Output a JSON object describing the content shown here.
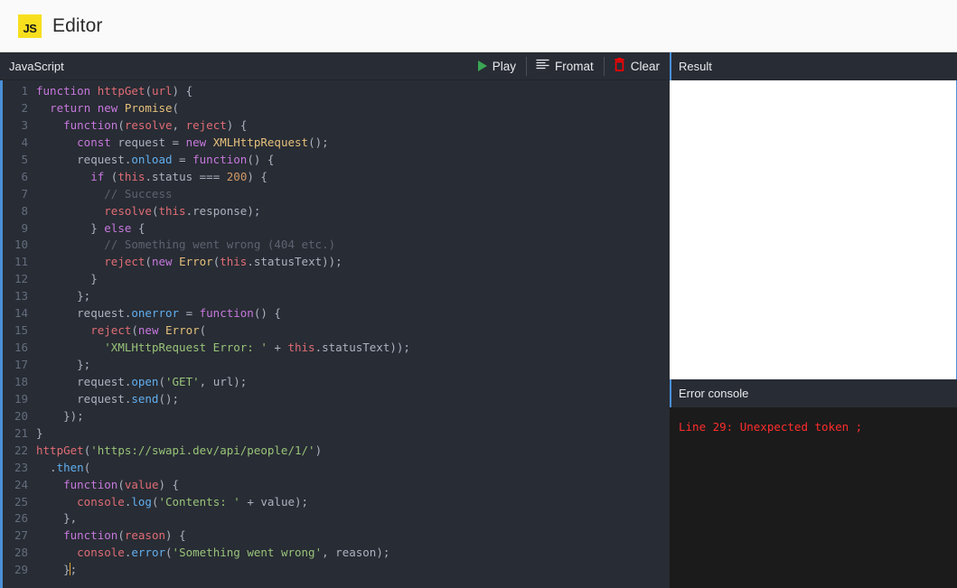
{
  "titlebar": {
    "logo_text": "JS",
    "title": "Editor",
    "logo_color": "#f7df1e"
  },
  "editor": {
    "language_label": "JavaScript",
    "toolbar": [
      {
        "label": "Play",
        "icon": "play-icon",
        "color": "#3aa655"
      },
      {
        "label": "Fromat",
        "icon": "format-icon",
        "color": "#e8eaed"
      },
      {
        "label": "Clear",
        "icon": "trash-icon",
        "color": "#ff0000"
      }
    ],
    "cursor_line": 29,
    "lines": [
      {
        "n": 1,
        "tokens": [
          {
            "t": "kw",
            "s": "function"
          },
          {
            "t": "pun",
            "s": " "
          },
          {
            "t": "fn",
            "s": "httpGet"
          },
          {
            "t": "pun",
            "s": "("
          },
          {
            "t": "var",
            "s": "url"
          },
          {
            "t": "pun",
            "s": ") {"
          }
        ]
      },
      {
        "n": 2,
        "tokens": [
          {
            "t": "pun",
            "s": "  "
          },
          {
            "t": "kw",
            "s": "return"
          },
          {
            "t": "pun",
            "s": " "
          },
          {
            "t": "kw",
            "s": "new"
          },
          {
            "t": "pun",
            "s": " "
          },
          {
            "t": "cls",
            "s": "Promise"
          },
          {
            "t": "pun",
            "s": "("
          }
        ]
      },
      {
        "n": 3,
        "tokens": [
          {
            "t": "pun",
            "s": "    "
          },
          {
            "t": "kw",
            "s": "function"
          },
          {
            "t": "pun",
            "s": "("
          },
          {
            "t": "var",
            "s": "resolve"
          },
          {
            "t": "pun",
            "s": ", "
          },
          {
            "t": "var",
            "s": "reject"
          },
          {
            "t": "pun",
            "s": ") {"
          }
        ]
      },
      {
        "n": 4,
        "tokens": [
          {
            "t": "pun",
            "s": "      "
          },
          {
            "t": "kw",
            "s": "const"
          },
          {
            "t": "pun",
            "s": " request = "
          },
          {
            "t": "kw",
            "s": "new"
          },
          {
            "t": "pun",
            "s": " "
          },
          {
            "t": "cls",
            "s": "XMLHttpRequest"
          },
          {
            "t": "pun",
            "s": "();"
          }
        ]
      },
      {
        "n": 5,
        "tokens": [
          {
            "t": "pun",
            "s": "      request."
          },
          {
            "t": "prop",
            "s": "onload"
          },
          {
            "t": "pun",
            "s": " = "
          },
          {
            "t": "kw",
            "s": "function"
          },
          {
            "t": "pun",
            "s": "() {"
          }
        ]
      },
      {
        "n": 6,
        "tokens": [
          {
            "t": "pun",
            "s": "        "
          },
          {
            "t": "kw",
            "s": "if"
          },
          {
            "t": "pun",
            "s": " ("
          },
          {
            "t": "this",
            "s": "this"
          },
          {
            "t": "pun",
            "s": ".status === "
          },
          {
            "t": "num",
            "s": "200"
          },
          {
            "t": "pun",
            "s": ") {"
          }
        ]
      },
      {
        "n": 7,
        "tokens": [
          {
            "t": "com",
            "s": "          // Success"
          }
        ]
      },
      {
        "n": 8,
        "tokens": [
          {
            "t": "pun",
            "s": "          "
          },
          {
            "t": "fn",
            "s": "resolve"
          },
          {
            "t": "pun",
            "s": "("
          },
          {
            "t": "this",
            "s": "this"
          },
          {
            "t": "pun",
            "s": ".response);"
          }
        ]
      },
      {
        "n": 9,
        "tokens": [
          {
            "t": "pun",
            "s": "        } "
          },
          {
            "t": "kw",
            "s": "else"
          },
          {
            "t": "pun",
            "s": " {"
          }
        ]
      },
      {
        "n": 10,
        "tokens": [
          {
            "t": "com",
            "s": "          // Something went wrong (404 etc.)"
          }
        ]
      },
      {
        "n": 11,
        "tokens": [
          {
            "t": "pun",
            "s": "          "
          },
          {
            "t": "fn",
            "s": "reject"
          },
          {
            "t": "pun",
            "s": "("
          },
          {
            "t": "kw",
            "s": "new"
          },
          {
            "t": "pun",
            "s": " "
          },
          {
            "t": "cls",
            "s": "Error"
          },
          {
            "t": "pun",
            "s": "("
          },
          {
            "t": "this",
            "s": "this"
          },
          {
            "t": "pun",
            "s": ".statusText));"
          }
        ]
      },
      {
        "n": 12,
        "tokens": [
          {
            "t": "pun",
            "s": "        }"
          }
        ]
      },
      {
        "n": 13,
        "tokens": [
          {
            "t": "pun",
            "s": "      };"
          }
        ]
      },
      {
        "n": 14,
        "tokens": [
          {
            "t": "pun",
            "s": "      request."
          },
          {
            "t": "prop",
            "s": "onerror"
          },
          {
            "t": "pun",
            "s": " = "
          },
          {
            "t": "kw",
            "s": "function"
          },
          {
            "t": "pun",
            "s": "() {"
          }
        ]
      },
      {
        "n": 15,
        "tokens": [
          {
            "t": "pun",
            "s": "        "
          },
          {
            "t": "fn",
            "s": "reject"
          },
          {
            "t": "pun",
            "s": "("
          },
          {
            "t": "kw",
            "s": "new"
          },
          {
            "t": "pun",
            "s": " "
          },
          {
            "t": "cls",
            "s": "Error"
          },
          {
            "t": "pun",
            "s": "("
          }
        ]
      },
      {
        "n": 16,
        "tokens": [
          {
            "t": "pun",
            "s": "          "
          },
          {
            "t": "str",
            "s": "'XMLHttpRequest Error: '"
          },
          {
            "t": "pun",
            "s": " + "
          },
          {
            "t": "this",
            "s": "this"
          },
          {
            "t": "pun",
            "s": ".statusText));"
          }
        ]
      },
      {
        "n": 17,
        "tokens": [
          {
            "t": "pun",
            "s": "      };"
          }
        ]
      },
      {
        "n": 18,
        "tokens": [
          {
            "t": "pun",
            "s": "      request."
          },
          {
            "t": "prop",
            "s": "open"
          },
          {
            "t": "pun",
            "s": "("
          },
          {
            "t": "str",
            "s": "'GET'"
          },
          {
            "t": "pun",
            "s": ", url);"
          }
        ]
      },
      {
        "n": 19,
        "tokens": [
          {
            "t": "pun",
            "s": "      request."
          },
          {
            "t": "prop",
            "s": "send"
          },
          {
            "t": "pun",
            "s": "();"
          }
        ]
      },
      {
        "n": 20,
        "tokens": [
          {
            "t": "pun",
            "s": "    });"
          }
        ]
      },
      {
        "n": 21,
        "tokens": [
          {
            "t": "pun",
            "s": "}"
          }
        ]
      },
      {
        "n": 22,
        "tokens": [
          {
            "t": "fn",
            "s": "httpGet"
          },
          {
            "t": "pun",
            "s": "("
          },
          {
            "t": "str",
            "s": "'https://swapi.dev/api/people/1/'"
          },
          {
            "t": "pun",
            "s": ")"
          }
        ]
      },
      {
        "n": 23,
        "tokens": [
          {
            "t": "pun",
            "s": "  ."
          },
          {
            "t": "prop",
            "s": "then"
          },
          {
            "t": "pun",
            "s": "("
          }
        ]
      },
      {
        "n": 24,
        "tokens": [
          {
            "t": "pun",
            "s": "    "
          },
          {
            "t": "kw",
            "s": "function"
          },
          {
            "t": "pun",
            "s": "("
          },
          {
            "t": "var",
            "s": "value"
          },
          {
            "t": "pun",
            "s": ") {"
          }
        ]
      },
      {
        "n": 25,
        "tokens": [
          {
            "t": "pun",
            "s": "      "
          },
          {
            "t": "fn",
            "s": "console"
          },
          {
            "t": "pun",
            "s": "."
          },
          {
            "t": "prop",
            "s": "log"
          },
          {
            "t": "pun",
            "s": "("
          },
          {
            "t": "str",
            "s": "'Contents: '"
          },
          {
            "t": "pun",
            "s": " + value);"
          }
        ]
      },
      {
        "n": 26,
        "tokens": [
          {
            "t": "pun",
            "s": "    },"
          }
        ]
      },
      {
        "n": 27,
        "tokens": [
          {
            "t": "pun",
            "s": "    "
          },
          {
            "t": "kw",
            "s": "function"
          },
          {
            "t": "pun",
            "s": "("
          },
          {
            "t": "var",
            "s": "reason"
          },
          {
            "t": "pun",
            "s": ") {"
          }
        ]
      },
      {
        "n": 28,
        "tokens": [
          {
            "t": "pun",
            "s": "      "
          },
          {
            "t": "fn",
            "s": "console"
          },
          {
            "t": "pun",
            "s": "."
          },
          {
            "t": "prop",
            "s": "error"
          },
          {
            "t": "pun",
            "s": "("
          },
          {
            "t": "str",
            "s": "'Something went wrong'"
          },
          {
            "t": "pun",
            "s": ", reason);"
          }
        ]
      },
      {
        "n": 29,
        "tokens": [
          {
            "t": "pun",
            "s": "    }"
          },
          {
            "t": "caret",
            "s": ""
          },
          {
            "t": "pun",
            "s": ";"
          }
        ]
      }
    ]
  },
  "result_panel": {
    "header": "Result",
    "content": ""
  },
  "error_console": {
    "header": "Error console",
    "message": "Line 29: Unexpected token ;",
    "message_color": "#ff2d2d"
  }
}
